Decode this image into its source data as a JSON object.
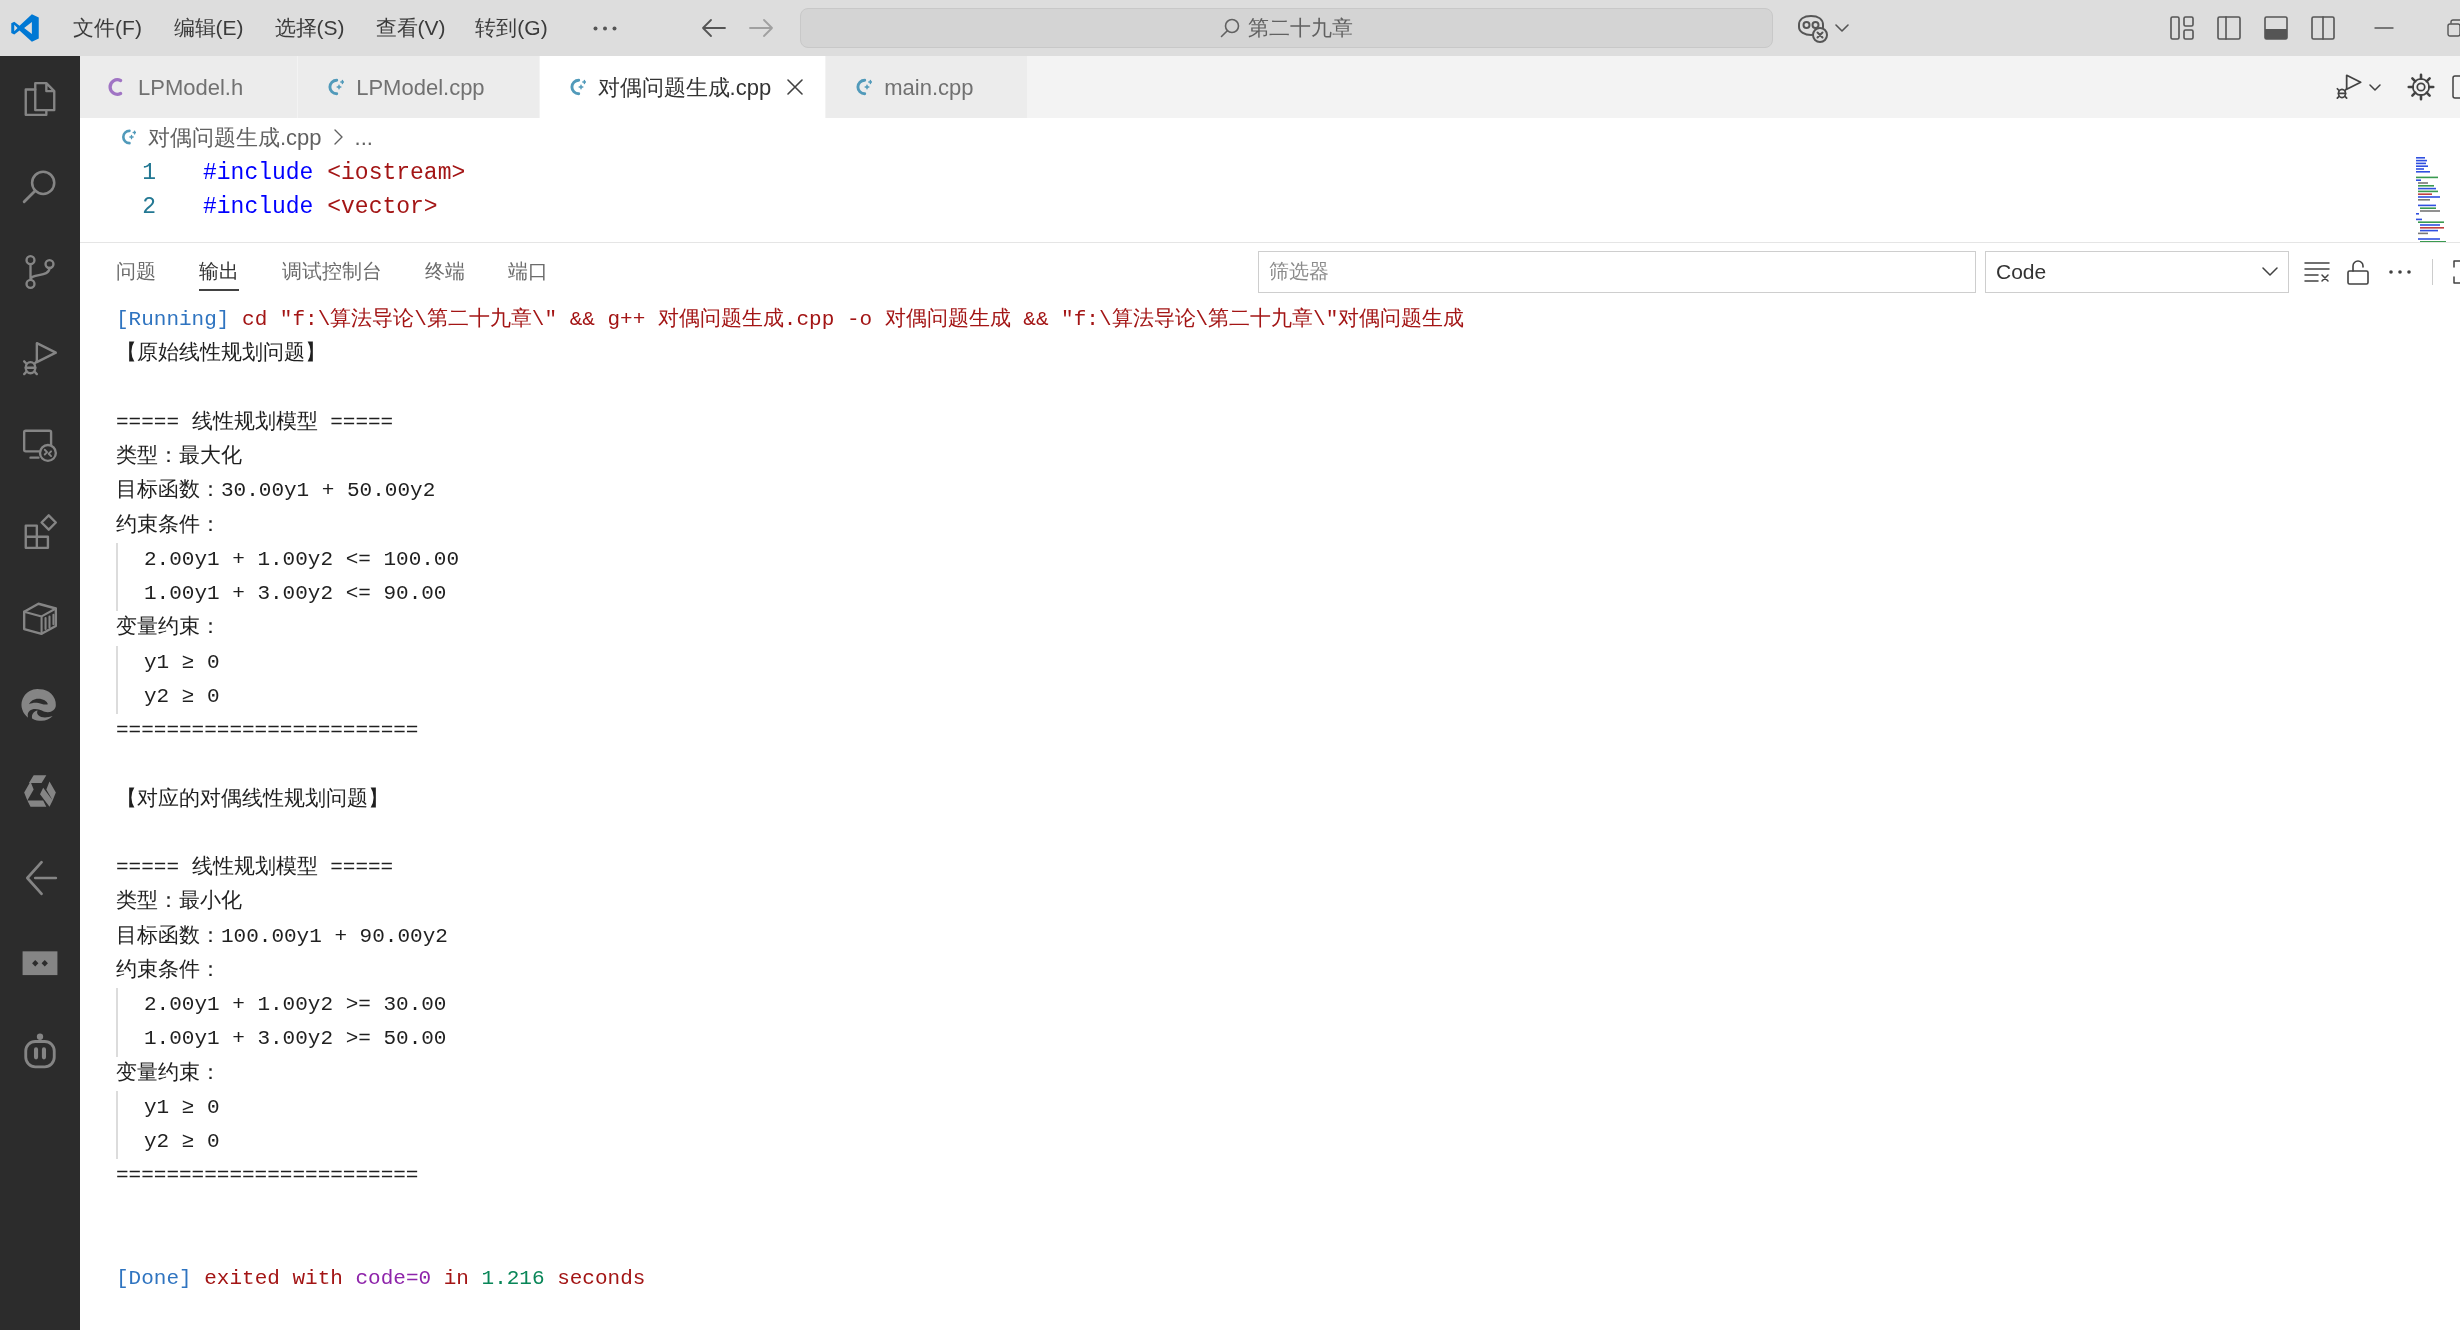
{
  "title_bar": {
    "menu": [
      "文件(F)",
      "编辑(E)",
      "选择(S)",
      "查看(V)",
      "转到(G)"
    ],
    "command_center": {
      "label": "第二十九章"
    },
    "layout_toggles": [
      {
        "kind": "primary_sidebar",
        "on": false
      },
      {
        "kind": "panel",
        "on": true
      },
      {
        "kind": "secondary_sidebar",
        "on": false
      }
    ]
  },
  "tabs": [
    {
      "label": "LPModel.h",
      "kind": "c_header",
      "selected": false
    },
    {
      "label": "LPModel.cpp",
      "kind": "cpp",
      "selected": false
    },
    {
      "label": "对偶问题生成.cpp",
      "kind": "cpp",
      "selected": true
    },
    {
      "label": "main.cpp",
      "kind": "cpp",
      "selected": false
    }
  ],
  "breadcrumb": [
    {
      "label": "对偶问题生成.cpp",
      "kind": "cpp"
    },
    {
      "label": "...",
      "kind": "more"
    }
  ],
  "editor": {
    "lines": [
      {
        "number": "1",
        "tokens": [
          {
            "text": "#include",
            "kind": "directive"
          },
          {
            "text": "<iostream>",
            "kind": "header"
          }
        ]
      },
      {
        "number": "2",
        "tokens": [
          {
            "text": "#include",
            "kind": "directive"
          },
          {
            "text": "<vector>",
            "kind": "header"
          }
        ]
      }
    ]
  },
  "panel": {
    "tabs": [
      {
        "label": "问题",
        "selected": false
      },
      {
        "label": "输出",
        "selected": true
      },
      {
        "label": "调试控制台",
        "selected": false
      },
      {
        "label": "终端",
        "selected": false
      },
      {
        "label": "端口",
        "selected": false
      }
    ],
    "filter": {
      "placeholder": "筛选器"
    },
    "channel": {
      "value": "Code"
    },
    "output": [
      {
        "kind": "status",
        "segments": [
          {
            "text": "[Running]",
            "kind": "tag"
          },
          {
            "text": "cd \"f:\\算法导论\\第二十九章\\\" && g++ 对偶问题生成.cpp -o 对偶问题生成 && \"f:\\算法导论\\第二十九章\\\"对偶问题生成",
            "kind": "message"
          }
        ]
      },
      {
        "kind": "text",
        "text": "【原始线性规划问题】"
      },
      {
        "kind": "blank"
      },
      {
        "kind": "text",
        "text": "===== 线性规划模型 ====="
      },
      {
        "kind": "text",
        "text": "类型：最大化"
      },
      {
        "kind": "text",
        "text": "目标函数：30.00y1 + 50.00y2"
      },
      {
        "kind": "text",
        "text": "约束条件：",
        "children": [
          {
            "kind": "text",
            "text": "2.00y1 + 1.00y2 <= 100.00"
          },
          {
            "kind": "text",
            "text": "1.00y1 + 3.00y2 <= 90.00"
          }
        ]
      },
      {
        "kind": "text",
        "text": "变量约束：",
        "children": [
          {
            "kind": "text",
            "text": "y1 ≥ 0"
          },
          {
            "kind": "text",
            "text": "y2 ≥ 0"
          }
        ]
      },
      {
        "kind": "text",
        "text": "========================"
      },
      {
        "kind": "blank"
      },
      {
        "kind": "text",
        "text": "【对应的对偶线性规划问题】"
      },
      {
        "kind": "blank"
      },
      {
        "kind": "text",
        "text": "===== 线性规划模型 ====="
      },
      {
        "kind": "text",
        "text": "类型：最小化"
      },
      {
        "kind": "text",
        "text": "目标函数：100.00y1 + 90.00y2"
      },
      {
        "kind": "text",
        "text": "约束条件：",
        "children": [
          {
            "kind": "text",
            "text": "2.00y1 + 1.00y2 >= 30.00"
          },
          {
            "kind": "text",
            "text": "1.00y1 + 3.00y2 >= 50.00"
          }
        ]
      },
      {
        "kind": "text",
        "text": "变量约束：",
        "children": [
          {
            "kind": "text",
            "text": "y1 ≥ 0"
          },
          {
            "kind": "text",
            "text": "y2 ≥ 0"
          }
        ]
      },
      {
        "kind": "text",
        "text": "========================"
      },
      {
        "kind": "blank"
      },
      {
        "kind": "blank"
      },
      {
        "kind": "status",
        "segments": [
          {
            "text": "[Done]",
            "kind": "tag"
          },
          {
            "text": "exited with",
            "kind": "message"
          },
          {
            "text": "code=0",
            "kind": "variable"
          },
          {
            "text": "in",
            "kind": "message"
          },
          {
            "text": "1.216",
            "kind": "number"
          },
          {
            "text": "seconds",
            "kind": "message"
          }
        ]
      }
    ]
  }
}
